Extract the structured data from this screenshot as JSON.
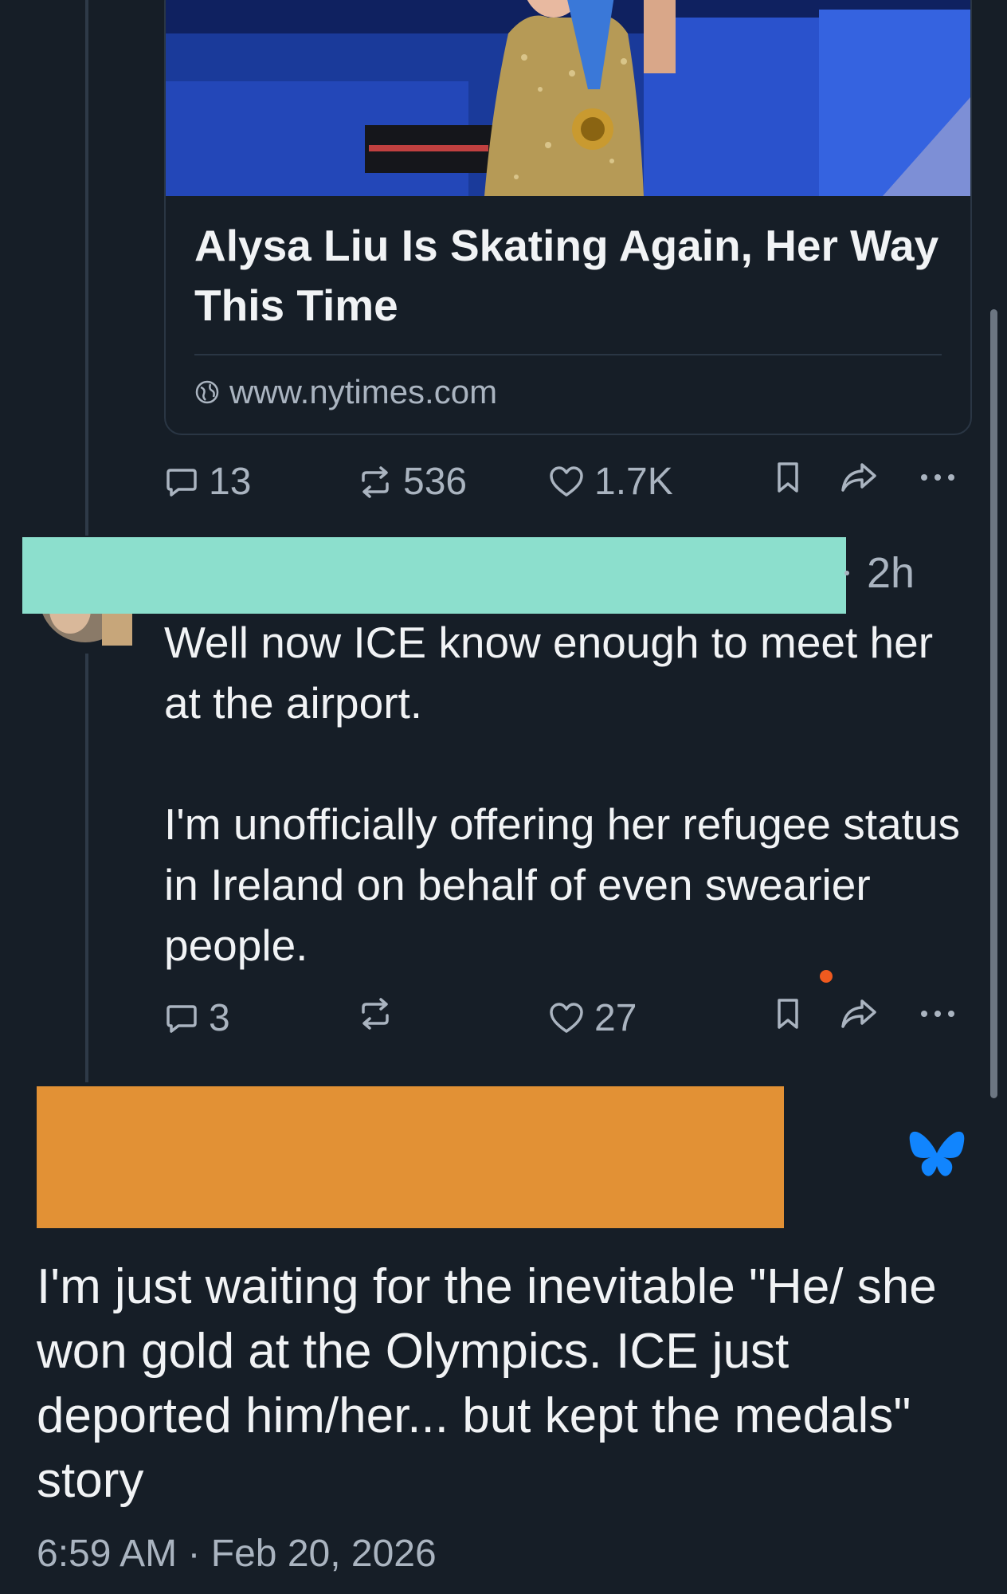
{
  "embed": {
    "title": "Alysa Liu Is Skating Again, Her Way This Time",
    "domain": "www.nytimes.com"
  },
  "quoted_post_actions": {
    "replies": "13",
    "reposts": "536",
    "likes": "1.7K"
  },
  "reply": {
    "time_ago": "2h",
    "paragraph1": "Well now ICE know enough to meet her at the airport.",
    "paragraph2": "I'm unofficially offering her refugee status in Ireland on behalf of even swearier people.",
    "actions": {
      "replies": "3",
      "likes": "27"
    }
  },
  "main_post": {
    "text": "I'm just waiting for the inevitable \"He/ she won gold at the Olympics. ICE just deported him/her... but kept the medals\" story",
    "timestamp": "6:59 AM · Feb 20, 2026"
  },
  "colors": {
    "background": "#161e27",
    "teal_redaction": "#8cdfcd",
    "orange_redaction": "#e29135",
    "bluesky_blue": "#1185fe",
    "muted_text": "#aab4c0"
  },
  "icons": [
    "globe-icon",
    "reply-icon",
    "repost-icon",
    "like-icon",
    "bookmark-icon",
    "share-icon",
    "more-icon",
    "bluesky-butterfly-icon"
  ]
}
